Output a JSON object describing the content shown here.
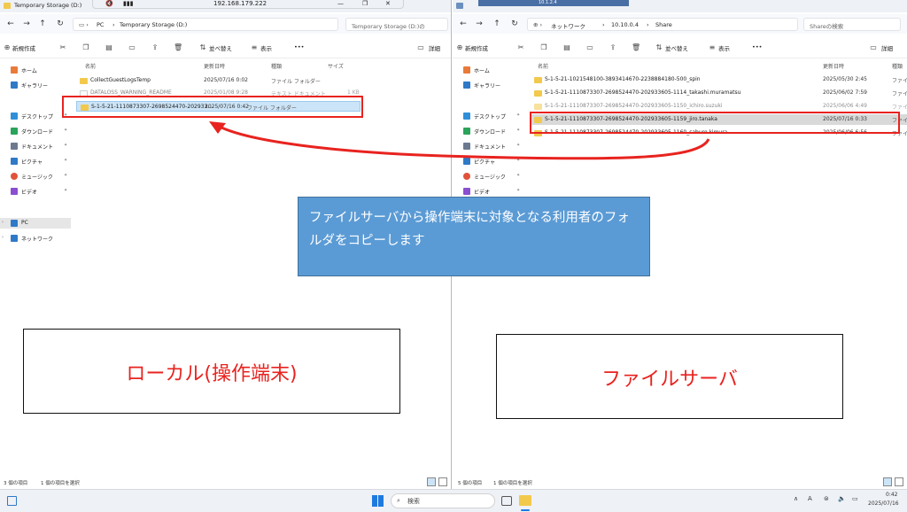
{
  "rdp_bar": {
    "ip": "192.168.179.222",
    "right_text": "10.1.2.4"
  },
  "left": {
    "title": "Temporary Storage (D:)",
    "address": {
      "pc": "PC",
      "drive": "Temporary Storage (D:)"
    },
    "search_placeholder": "Temporary Storage (D:)の",
    "toolbar": {
      "new": "新規作成",
      "sort": "並べ替え",
      "view": "表示",
      "more": "•••",
      "details": "詳細"
    },
    "sidebar": [
      {
        "label": "ホーム",
        "icon": "home-icon",
        "color": "#e97a3a"
      },
      {
        "label": "ギャラリー",
        "icon": "gallery-icon",
        "color": "#2f79c7"
      },
      {
        "label": "デスクトップ",
        "icon": "desktop-icon",
        "color": "#2f8fd9"
      },
      {
        "label": "ダウンロード",
        "icon": "download-icon",
        "color": "#2aa35b"
      },
      {
        "label": "ドキュメント",
        "icon": "document-icon",
        "color": "#6b7a8f"
      },
      {
        "label": "ピクチャ",
        "icon": "pictures-icon",
        "color": "#2f79c7"
      },
      {
        "label": "ミュージック",
        "icon": "music-icon",
        "color": "#e0533a"
      },
      {
        "label": "ビデオ",
        "icon": "video-icon",
        "color": "#8a4fd0"
      },
      {
        "label": "PC",
        "icon": "pc-icon",
        "color": "#2f79c7"
      },
      {
        "label": "ネットワーク",
        "icon": "network-icon",
        "color": "#2f79c7"
      }
    ],
    "columns": {
      "name": "名前",
      "date": "更新日時",
      "type": "種類",
      "size": "サイズ"
    },
    "files": [
      {
        "name": "CollectGuestLogsTemp",
        "date": "2025/07/16 0:02",
        "type": "ファイル フォルダー",
        "size": ""
      },
      {
        "name": "DATALOSS_WARNING_README",
        "date": "2025/01/08 9:28",
        "type": "テキスト ドキュメント",
        "size": "1 KB"
      },
      {
        "name": "S-1-5-21-1110873307-2698524470-202933...",
        "date": "2025/07/16 0:42",
        "type": "ファイル フォルダー",
        "size": ""
      }
    ],
    "status": {
      "count": "3 個の項目",
      "selected": "1 個の項目を選択"
    }
  },
  "right": {
    "address": {
      "network": "ネットワーク",
      "host": "10.10.0.4",
      "share": "Share"
    },
    "search_placeholder": "Shareの検索",
    "toolbar": {
      "new": "新規作成",
      "sort": "並べ替え",
      "view": "表示",
      "more": "•••",
      "details": "詳細"
    },
    "sidebar": [
      {
        "label": "ホーム",
        "icon": "home-icon",
        "color": "#e97a3a"
      },
      {
        "label": "ギャラリー",
        "icon": "gallery-icon",
        "color": "#2f79c7"
      },
      {
        "label": "デスクトップ",
        "icon": "desktop-icon",
        "color": "#2f8fd9"
      },
      {
        "label": "ダウンロード",
        "icon": "download-icon",
        "color": "#2aa35b"
      },
      {
        "label": "ドキュメント",
        "icon": "document-icon",
        "color": "#6b7a8f"
      },
      {
        "label": "ピクチャ",
        "icon": "pictures-icon",
        "color": "#2f79c7"
      },
      {
        "label": "ミュージック",
        "icon": "music-icon",
        "color": "#e0533a"
      },
      {
        "label": "ビデオ",
        "icon": "video-icon",
        "color": "#8a4fd0"
      }
    ],
    "columns": {
      "name": "名前",
      "date": "更新日時",
      "type": "種類"
    },
    "files": [
      {
        "name": "S-1-5-21-1021548100-3893414670-2238884180-500_spin",
        "date": "2025/05/30 2:45",
        "type": "ファイ"
      },
      {
        "name": "S-1-5-21-1110873307-2698524470-202933605-1114_takashi.muramatsu",
        "date": "2025/06/02 7:59",
        "type": "ファイ"
      },
      {
        "name": "S-1-5-21-1110873307-2698524470-202933605-1150_ichiro.suzuki",
        "date": "2025/06/06 4:49",
        "type": "ファイ"
      },
      {
        "name": "S-1-5-21-1110873307-2698524470-202933605-1159_jiro.tanaka",
        "date": "2025/07/16 0:33",
        "type": "ファイル"
      },
      {
        "name": "S-1-5-21-1110873307-2698524470-202933605-1160_saburo.kimura",
        "date": "2025/06/06 6:56",
        "type": "ファイ"
      }
    ],
    "status": {
      "count": "5 個の項目",
      "selected": "1 個の項目を選択"
    }
  },
  "callout": {
    "text": "ファイルサーバから操作端末に対象となる利用者のフォルダをコピーします"
  },
  "label_local": "ローカル(操作端末)",
  "label_server": "ファイルサーバ",
  "taskbar": {
    "search": "検索",
    "ime": "A",
    "time": "0:42",
    "date": "2025/07/16"
  },
  "colors": {
    "annotation_red": "#e8231f",
    "callout_blue": "#5b9bd5",
    "selected_blue": "#cce4f7"
  }
}
